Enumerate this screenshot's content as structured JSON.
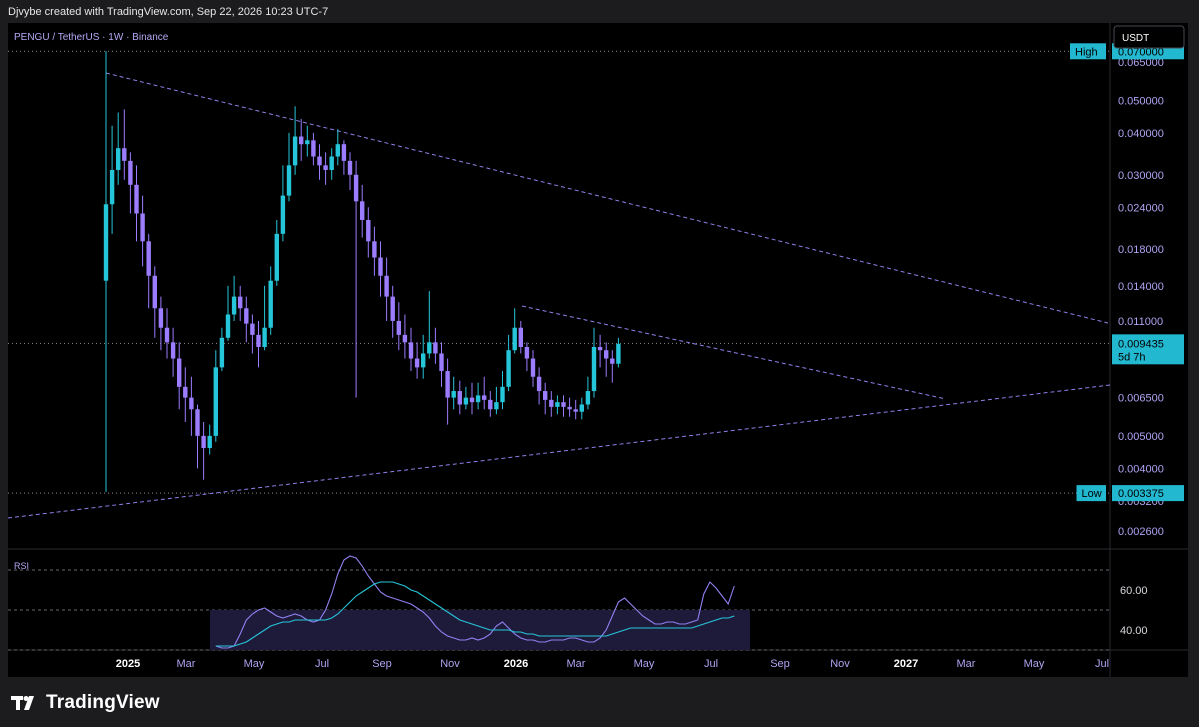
{
  "header": {
    "credit": "Djvybe created with TradingView.com, Sep 22, 2026 10:23 UTC-7"
  },
  "chart_title": "PENGU / TetherUS · 1W · Binance",
  "currency_button": "USDT",
  "footer": {
    "brand": "TradingView"
  },
  "colors": {
    "up": "#26c6da",
    "down": "#9c7cff",
    "background": "#000000",
    "axis_text": "#b0a4f2",
    "rsi": "#8f82f0",
    "rsi_ma": "#26c6da",
    "tag_bg": "#22b8cf"
  },
  "chart_data": [
    {
      "type": "candlestick",
      "scale": "log",
      "ylim": [
        0.0023,
        0.085
      ],
      "y_ticks": [
        "0.065000",
        "0.050000",
        "0.040000",
        "0.030000",
        "0.024000",
        "0.018000",
        "0.014000",
        "0.011000",
        "0.006500",
        "0.005000",
        "0.004000",
        "0.003200",
        "0.002600"
      ],
      "x_ticks": [
        "2025",
        "Mar",
        "May",
        "Jul",
        "Sep",
        "Nov",
        "2026",
        "Mar",
        "May",
        "Jul",
        "Sep",
        "Nov",
        "2027",
        "Mar",
        "May",
        "Jul"
      ],
      "high": {
        "label": "High",
        "value": "0.070000"
      },
      "low": {
        "label": "Low",
        "value": "0.003375"
      },
      "last_price": {
        "value": "0.009435",
        "countdown": "5d 7h"
      },
      "candles": [
        [
          0.0145,
          0.0245,
          0.07,
          0.0034
        ],
        [
          0.0245,
          0.031,
          0.042,
          0.02
        ],
        [
          0.031,
          0.036,
          0.046,
          0.028
        ],
        [
          0.036,
          0.033,
          0.047,
          0.029
        ],
        [
          0.033,
          0.028,
          0.035,
          0.023
        ],
        [
          0.028,
          0.023,
          0.032,
          0.019
        ],
        [
          0.023,
          0.019,
          0.026,
          0.016
        ],
        [
          0.019,
          0.015,
          0.02,
          0.012
        ],
        [
          0.015,
          0.012,
          0.016,
          0.0098
        ],
        [
          0.012,
          0.0105,
          0.013,
          0.009
        ],
        [
          0.0105,
          0.0095,
          0.012,
          0.0085
        ],
        [
          0.0095,
          0.0085,
          0.0105,
          0.0075
        ],
        [
          0.0085,
          0.007,
          0.0095,
          0.006
        ],
        [
          0.007,
          0.0065,
          0.008,
          0.0055
        ],
        [
          0.0065,
          0.006,
          0.0075,
          0.005
        ],
        [
          0.006,
          0.005,
          0.0062,
          0.004
        ],
        [
          0.005,
          0.0046,
          0.0055,
          0.0037
        ],
        [
          0.0046,
          0.005,
          0.0054,
          0.0044
        ],
        [
          0.005,
          0.008,
          0.009,
          0.0048
        ],
        [
          0.008,
          0.0098,
          0.0105,
          0.0078
        ],
        [
          0.0098,
          0.0115,
          0.014,
          0.0096
        ],
        [
          0.0115,
          0.013,
          0.015,
          0.011
        ],
        [
          0.013,
          0.012,
          0.014,
          0.011
        ],
        [
          0.012,
          0.0108,
          0.013,
          0.0095
        ],
        [
          0.0108,
          0.01,
          0.0115,
          0.0088
        ],
        [
          0.01,
          0.0092,
          0.011,
          0.008
        ],
        [
          0.0092,
          0.0105,
          0.014,
          0.009
        ],
        [
          0.0105,
          0.0145,
          0.016,
          0.01
        ],
        [
          0.0145,
          0.02,
          0.022,
          0.014
        ],
        [
          0.02,
          0.026,
          0.032,
          0.019
        ],
        [
          0.026,
          0.032,
          0.04,
          0.025
        ],
        [
          0.032,
          0.039,
          0.048,
          0.03
        ],
        [
          0.039,
          0.037,
          0.044,
          0.033
        ],
        [
          0.037,
          0.038,
          0.042,
          0.034
        ],
        [
          0.038,
          0.034,
          0.04,
          0.032
        ],
        [
          0.034,
          0.032,
          0.037,
          0.029
        ],
        [
          0.032,
          0.031,
          0.035,
          0.028
        ],
        [
          0.031,
          0.034,
          0.036,
          0.029
        ],
        [
          0.034,
          0.037,
          0.041,
          0.032
        ],
        [
          0.037,
          0.033,
          0.038,
          0.03
        ],
        [
          0.033,
          0.03,
          0.035,
          0.027
        ],
        [
          0.03,
          0.025,
          0.033,
          0.0065
        ],
        [
          0.025,
          0.022,
          0.028,
          0.0195
        ],
        [
          0.022,
          0.019,
          0.024,
          0.017
        ],
        [
          0.019,
          0.017,
          0.021,
          0.015
        ],
        [
          0.017,
          0.015,
          0.019,
          0.013
        ],
        [
          0.015,
          0.013,
          0.017,
          0.011
        ],
        [
          0.013,
          0.011,
          0.014,
          0.0098
        ],
        [
          0.011,
          0.01,
          0.0125,
          0.009
        ],
        [
          0.01,
          0.0095,
          0.0115,
          0.0085
        ],
        [
          0.0095,
          0.0085,
          0.0105,
          0.0078
        ],
        [
          0.0085,
          0.008,
          0.0095,
          0.0074
        ],
        [
          0.008,
          0.0088,
          0.01,
          0.0074
        ],
        [
          0.0088,
          0.0095,
          0.0135,
          0.0085
        ],
        [
          0.0095,
          0.0088,
          0.0105,
          0.0082
        ],
        [
          0.0088,
          0.0078,
          0.0095,
          0.007
        ],
        [
          0.0078,
          0.0065,
          0.0085,
          0.0054
        ],
        [
          0.0065,
          0.0068,
          0.0075,
          0.006
        ],
        [
          0.0068,
          0.0062,
          0.0073,
          0.0058
        ],
        [
          0.0062,
          0.0065,
          0.007,
          0.006
        ],
        [
          0.0065,
          0.0063,
          0.0072,
          0.0058
        ],
        [
          0.0063,
          0.0066,
          0.0072,
          0.006
        ],
        [
          0.0066,
          0.0064,
          0.0075,
          0.006
        ],
        [
          0.0064,
          0.006,
          0.0068,
          0.0057
        ],
        [
          0.006,
          0.0063,
          0.007,
          0.0058
        ],
        [
          0.0063,
          0.007,
          0.0078,
          0.006
        ],
        [
          0.007,
          0.009,
          0.01,
          0.0068
        ],
        [
          0.009,
          0.0105,
          0.012,
          0.0088
        ],
        [
          0.0105,
          0.0092,
          0.011,
          0.0088
        ],
        [
          0.0092,
          0.0085,
          0.0095,
          0.0078
        ],
        [
          0.0085,
          0.0075,
          0.009,
          0.007
        ],
        [
          0.0075,
          0.0068,
          0.008,
          0.0062
        ],
        [
          0.0068,
          0.0064,
          0.0072,
          0.0058
        ],
        [
          0.0064,
          0.0061,
          0.0068,
          0.0057
        ],
        [
          0.0061,
          0.0063,
          0.0066,
          0.0058
        ],
        [
          0.0063,
          0.0061,
          0.0066,
          0.0057
        ],
        [
          0.0061,
          0.006,
          0.0065,
          0.0057
        ],
        [
          0.006,
          0.0059,
          0.0064,
          0.0056
        ],
        [
          0.0059,
          0.0062,
          0.0065,
          0.0056
        ],
        [
          0.0062,
          0.0068,
          0.0075,
          0.006
        ],
        [
          0.0068,
          0.0092,
          0.0105,
          0.0065
        ],
        [
          0.0092,
          0.009,
          0.01,
          0.008
        ],
        [
          0.009,
          0.0085,
          0.0095,
          0.0075
        ],
        [
          0.0085,
          0.0082,
          0.009,
          0.0072
        ],
        [
          0.0082,
          0.0094,
          0.0098,
          0.008
        ]
      ]
    },
    {
      "type": "line",
      "title": "RSI",
      "ylim": [
        30,
        80
      ],
      "y_ticks": [
        "60.00",
        "40.00"
      ],
      "bands": [
        70,
        50,
        30
      ],
      "series": [
        {
          "values": [
            32,
            31,
            31,
            32,
            38,
            45,
            48,
            50,
            51,
            49,
            47,
            46,
            47,
            48,
            47,
            45,
            44,
            45,
            50,
            58,
            68,
            75,
            77,
            76,
            72,
            67,
            63,
            59,
            57,
            56,
            55,
            54,
            53,
            51,
            49,
            46,
            42,
            39,
            37,
            36,
            35,
            35,
            36,
            35,
            36,
            38,
            42,
            44,
            41,
            38,
            36,
            35,
            35,
            34,
            34,
            35,
            35,
            35,
            36,
            36,
            35,
            34,
            34,
            36,
            40,
            47,
            54,
            56,
            53,
            50,
            47,
            45,
            43,
            43,
            44,
            44,
            43,
            43,
            44,
            45,
            58,
            64,
            61,
            57,
            53,
            62
          ]
        },
        {
          "values": [
            32,
            32,
            32,
            32,
            33,
            34,
            36,
            38,
            40,
            42,
            43,
            44,
            44,
            45,
            45,
            45,
            45,
            45,
            45,
            46,
            48,
            51,
            54,
            57,
            59,
            61,
            63,
            64,
            64,
            64,
            63,
            62,
            60,
            59,
            57,
            55,
            53,
            51,
            49,
            47,
            45,
            44,
            43,
            42,
            41,
            40,
            40,
            40,
            40,
            39,
            39,
            38,
            38,
            37,
            37,
            37,
            37,
            37,
            37,
            37,
            37,
            37,
            37,
            37,
            37,
            38,
            39,
            40,
            41,
            41,
            41,
            41,
            41,
            41,
            41,
            41,
            41,
            41,
            41,
            42,
            43,
            44,
            45,
            46,
            46,
            47
          ]
        }
      ]
    }
  ]
}
